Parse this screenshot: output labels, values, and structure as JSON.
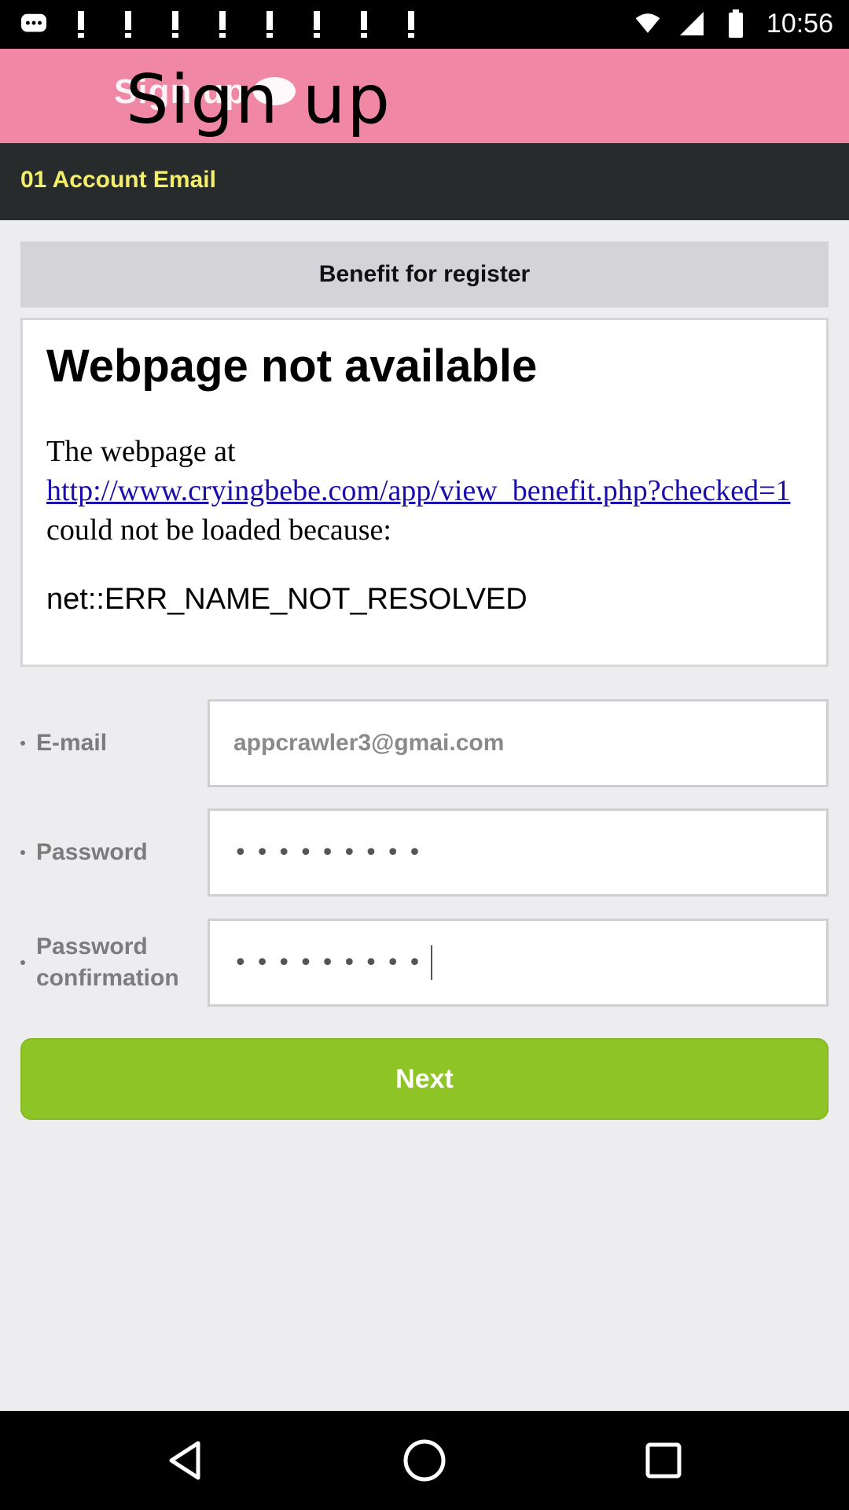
{
  "status_bar": {
    "time": "10:56",
    "left_icons": [
      "messages-icon",
      "notification-icon",
      "notification-icon",
      "notification-icon",
      "notification-icon",
      "notification-icon",
      "notification-icon",
      "notification-icon",
      "notification-icon"
    ],
    "right_icons": [
      "wifi-icon",
      "signal-icon",
      "battery-icon"
    ]
  },
  "header": {
    "logo_text": "Sign up",
    "title": "Sign up",
    "colors": {
      "background": "#ef87a5"
    }
  },
  "step": {
    "label": "01 Account Email",
    "colors": {
      "background": "#272b2c",
      "text": "#f3ee6b"
    }
  },
  "benefit": {
    "header": "Benefit for register",
    "error": {
      "title": "Webpage not available",
      "body_prefix": "The webpage at ",
      "link": "http://www.cryingbebe.com/app/view_benefit.php?checked=1",
      "body_suffix": " could not be loaded because:",
      "code": "net::ERR_NAME_NOT_RESOLVED"
    }
  },
  "form": {
    "email": {
      "label": "E-mail",
      "value": "appcrawler3@gmai.com"
    },
    "password": {
      "label": "Password",
      "value": "•••••••••"
    },
    "password_confirmation": {
      "label_line1": "Password",
      "label_line2": "confirmation",
      "value": "•••••••••"
    }
  },
  "next_button": {
    "label": "Next",
    "color": "#8fc427"
  },
  "nav_bar": {
    "buttons": [
      "back-icon",
      "home-icon",
      "recents-icon"
    ]
  }
}
